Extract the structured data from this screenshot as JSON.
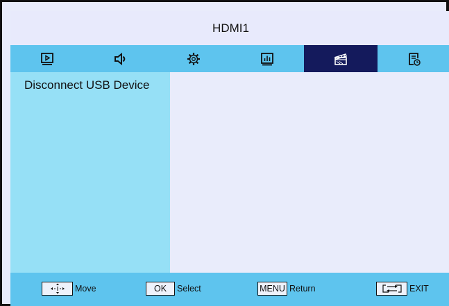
{
  "header": {
    "title": "HDMI1"
  },
  "tabs": [
    {
      "icon": "picture-icon",
      "active": false
    },
    {
      "icon": "speaker-icon",
      "active": false
    },
    {
      "icon": "gear-icon",
      "active": false
    },
    {
      "icon": "bar-chart-icon",
      "active": false
    },
    {
      "icon": "clapperboard-icon",
      "active": true
    },
    {
      "icon": "schedule-icon",
      "active": false
    }
  ],
  "menu": {
    "items": [
      {
        "label": "Disconnect USB Device"
      }
    ]
  },
  "footer": {
    "move": {
      "key_icon": "dpad-arrows-icon",
      "label": "Move"
    },
    "select": {
      "key": "OK",
      "label": "Select"
    },
    "return": {
      "key": "MENU",
      "label": "Return"
    },
    "exit": {
      "key_icon": "swap-arrows-icon",
      "label": "EXIT"
    }
  },
  "colors": {
    "tab_bar": "#5ec4ee",
    "active_tab": "#141a5c",
    "side_menu": "#96e0f6",
    "background": "#e9ecfb",
    "border": "#111111"
  }
}
